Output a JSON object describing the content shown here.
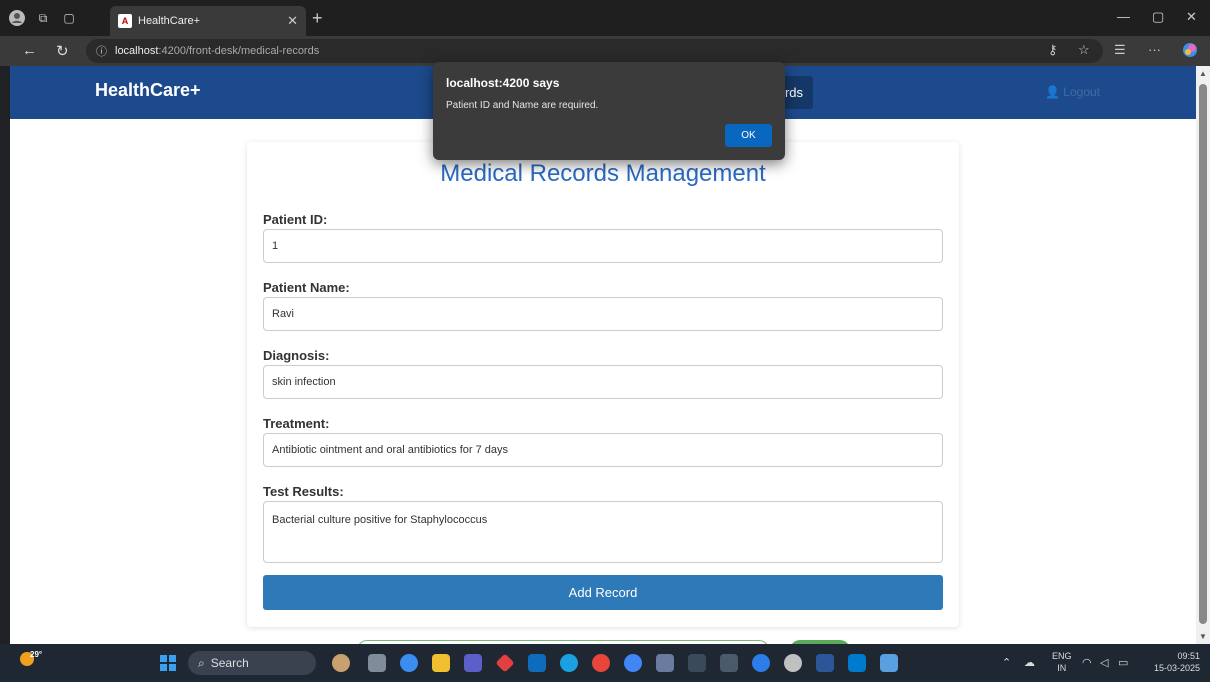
{
  "browser": {
    "tab_title": "HealthCare+",
    "tab_favicon": "A",
    "url_host": "localhost",
    "url_path": ":4200/front-desk/medical-records"
  },
  "app": {
    "brand": "HealthCare+",
    "nav_active_suffix": "rds",
    "logout_label": "Logout"
  },
  "form": {
    "title": "Medical Records Management",
    "patient_id_label": "Patient ID:",
    "patient_id_value": "1",
    "patient_name_label": "Patient Name:",
    "patient_name_value": "Ravi",
    "diagnosis_label": "Diagnosis:",
    "diagnosis_value": "skin infection",
    "treatment_label": "Treatment:",
    "treatment_value": "Antibiotic ointment and oral antibiotics for 7 days",
    "test_results_label": "Test Results:",
    "test_results_value": "Bacterial culture positive for Staphylococcus",
    "submit_label": "Add Record"
  },
  "dialog": {
    "title": "localhost:4200 says",
    "message": "Patient ID and Name are required.",
    "ok_label": "OK"
  },
  "taskbar": {
    "temperature": "29°",
    "search_label": "Search",
    "lang_line1": "ENG",
    "lang_line2": "IN",
    "time": "09:51",
    "date": "15-03-2025"
  },
  "colors": {
    "header_bg": "#1d4a8c",
    "title_blue": "#2a6bc2",
    "button_blue": "#2e7ab8",
    "dialog_ok": "#0a67c0"
  }
}
